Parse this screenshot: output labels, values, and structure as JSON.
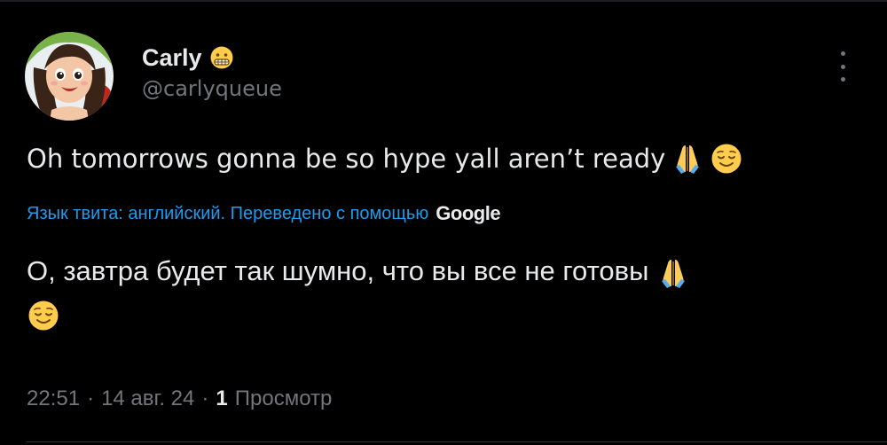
{
  "author": {
    "name": "Carly",
    "name_emoji": "grimacing-face-emoji",
    "handle": "@carlyqueue"
  },
  "tweet": {
    "text": "Oh tomorrows gonna be so hype yall aren’t ready",
    "emojis": [
      "folded-hands-emoji",
      "relieved-face-emoji"
    ]
  },
  "translation": {
    "note": "Язык твита: английский. Переведено с помощью",
    "provider": "Google",
    "text": "О, завтра будет так шумно, что вы все не готовы"
  },
  "meta": {
    "time": "22:51",
    "date": "14 авг. 24",
    "separator": "·",
    "views_count": "1",
    "views_label": "Просмотр"
  },
  "colors": {
    "background": "#000000",
    "text": "#e7e9ea",
    "secondary": "#71767b",
    "link": "#1d9bf0"
  }
}
